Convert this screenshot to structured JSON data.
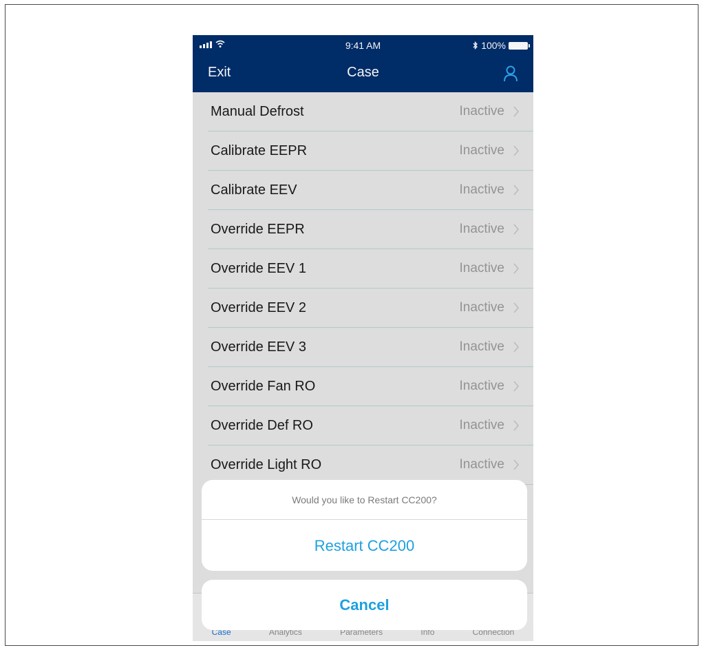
{
  "status_bar": {
    "time": "9:41 AM",
    "battery": "100%",
    "bluetooth_icon": "bluetooth-icon"
  },
  "header": {
    "exit_label": "Exit",
    "title": "Case",
    "user_icon": "user-icon"
  },
  "list": {
    "items": [
      {
        "label": "Manual Defrost",
        "status": "Inactive"
      },
      {
        "label": "Calibrate EEPR",
        "status": "Inactive"
      },
      {
        "label": "Calibrate EEV",
        "status": "Inactive"
      },
      {
        "label": "Override EEPR",
        "status": "Inactive"
      },
      {
        "label": "Override EEV 1",
        "status": "Inactive"
      },
      {
        "label": "Override EEV 2",
        "status": "Inactive"
      },
      {
        "label": "Override EEV 3",
        "status": "Inactive"
      },
      {
        "label": "Override Fan RO",
        "status": "Inactive"
      },
      {
        "label": "Override Def RO",
        "status": "Inactive"
      },
      {
        "label": "Override Light RO",
        "status": "Inactive"
      }
    ]
  },
  "tabbar": {
    "tabs": [
      "Case",
      "Analytics",
      "Parameters",
      "Info",
      "Connection"
    ],
    "active": "Case"
  },
  "action_sheet": {
    "message": "Would you like to Restart CC200?",
    "action_label": "Restart CC200",
    "cancel_label": "Cancel"
  },
  "colors": {
    "navbar": "#002e6d",
    "accent": "#1ea0e0",
    "status_text": "#9a9a9a"
  }
}
